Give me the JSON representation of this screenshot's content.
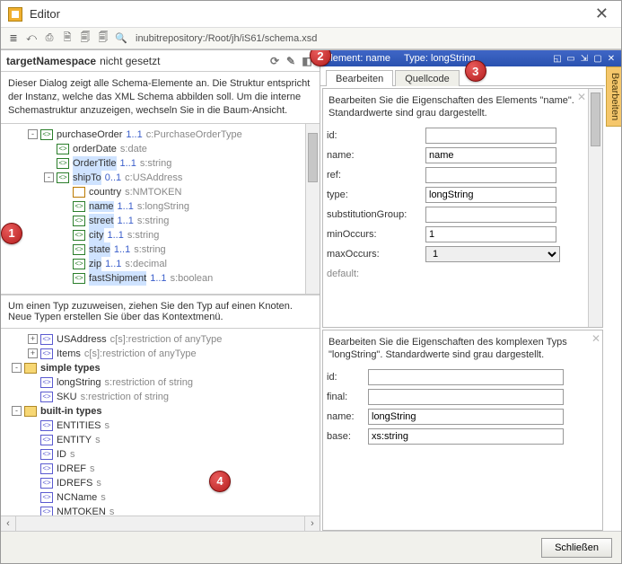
{
  "window": {
    "title": "Editor"
  },
  "toolbar": {
    "path": "inubitrepository:/Root/jh/iS61/schema.xsd"
  },
  "ns": {
    "label": "targetNamespace",
    "status": "nicht gesetzt"
  },
  "leftHint": "Dieser Dialog zeigt alle Schema-Elemente an. Die Struktur entspricht der Instanz, welche das XML Schema abbilden soll. Um die interne Schemastruktur anzuzeigen, wechseln Sie in die Baum-Ansicht.",
  "tree": [
    {
      "depth": 1,
      "exp": "-",
      "icon": "elem",
      "label": "purchaseOrder",
      "occ": "1..1",
      "tinfo": "c:PurchaseOrderType"
    },
    {
      "depth": 2,
      "exp": "",
      "icon": "elem",
      "label": "orderDate",
      "tinfo": "s:date"
    },
    {
      "depth": 2,
      "exp": "",
      "icon": "elem",
      "label": "OrderTitle",
      "occ": "1..1",
      "tinfo": "s:string",
      "hl": true
    },
    {
      "depth": 2,
      "exp": "-",
      "icon": "elem",
      "label": "shipTo",
      "occ": "0..1",
      "tinfo": "c:USAddress",
      "hl": true
    },
    {
      "depth": 3,
      "exp": "",
      "icon": "attr",
      "label": "country",
      "tinfo": "s:NMTOKEN"
    },
    {
      "depth": 3,
      "exp": "",
      "icon": "elem",
      "label": "name",
      "occ": "1..1",
      "tinfo": "s:longString",
      "hl": true,
      "selected": true
    },
    {
      "depth": 3,
      "exp": "",
      "icon": "elem",
      "label": "street",
      "occ": "1..1",
      "tinfo": "s:string",
      "hl": true
    },
    {
      "depth": 3,
      "exp": "",
      "icon": "elem",
      "label": "city",
      "occ": "1..1",
      "tinfo": "s:string",
      "hl": true
    },
    {
      "depth": 3,
      "exp": "",
      "icon": "elem",
      "label": "state",
      "occ": "1..1",
      "tinfo": "s:string",
      "hl": true
    },
    {
      "depth": 3,
      "exp": "",
      "icon": "elem",
      "label": "zip",
      "occ": "1..1",
      "tinfo": "s:decimal",
      "hl": true
    },
    {
      "depth": 3,
      "exp": "",
      "icon": "elem",
      "label": "fastShipment",
      "occ": "1..1",
      "tinfo": "s:boolean",
      "hl": true
    }
  ],
  "typesHint": "Um einen Typ zuzuweisen, ziehen Sie den Typ auf einen Knoten. Neue Typen erstellen Sie über das Kontextmenü.",
  "typesTree": [
    {
      "depth": 1,
      "exp": "+",
      "icon": "type",
      "label": "USAddress",
      "tinfo": "c[s]:restriction of anyType"
    },
    {
      "depth": 1,
      "exp": "+",
      "icon": "type",
      "label": "Items",
      "tinfo": "c[s]:restriction of anyType"
    },
    {
      "depth": 0,
      "exp": "-",
      "icon": "folder",
      "label": "simple types",
      "bold": true
    },
    {
      "depth": 1,
      "exp": "",
      "icon": "type",
      "label": "longString",
      "tinfo": "s:restriction of string",
      "selected": true
    },
    {
      "depth": 1,
      "exp": "",
      "icon": "type",
      "label": "SKU",
      "tinfo": "s:restriction of string"
    },
    {
      "depth": 0,
      "exp": "-",
      "icon": "folder",
      "label": "built-in types",
      "bold": true
    },
    {
      "depth": 1,
      "exp": "",
      "icon": "type",
      "label": "ENTITIES",
      "tinfo": "s"
    },
    {
      "depth": 1,
      "exp": "",
      "icon": "type",
      "label": "ENTITY",
      "tinfo": "s"
    },
    {
      "depth": 1,
      "exp": "",
      "icon": "type",
      "label": "ID",
      "tinfo": "s"
    },
    {
      "depth": 1,
      "exp": "",
      "icon": "type",
      "label": "IDREF",
      "tinfo": "s"
    },
    {
      "depth": 1,
      "exp": "",
      "icon": "type",
      "label": "IDREFS",
      "tinfo": "s"
    },
    {
      "depth": 1,
      "exp": "",
      "icon": "type",
      "label": "NCName",
      "tinfo": "s"
    },
    {
      "depth": 1,
      "exp": "",
      "icon": "type",
      "label": "NMTOKEN",
      "tinfo": "s"
    }
  ],
  "panelHead": {
    "element": "Element: name",
    "type": "Type: longString"
  },
  "sideTab": "Bearbeiten",
  "tabs": {
    "edit": "Bearbeiten",
    "source": "Quellcode"
  },
  "elemForm": {
    "desc": "Bearbeiten Sie die Eigenschaften des Elements \"name\". Standardwerte sind grau dargestellt.",
    "idLabel": "id:",
    "idVal": "",
    "nameLabel": "name:",
    "nameVal": "name",
    "refLabel": "ref:",
    "refVal": "",
    "typeLabel": "type:",
    "typeVal": "longString",
    "substLabel": "substitutionGroup:",
    "substVal": "",
    "minLabel": "minOccurs:",
    "minVal": "1",
    "maxLabel": "maxOccurs:",
    "maxVal": "1",
    "defaultLabel": "default:"
  },
  "typeForm": {
    "desc": "Bearbeiten Sie die Eigenschaften des komplexen Typs \"longString\". Standardwerte sind grau dargestellt.",
    "idLabel": "id:",
    "idVal": "",
    "finalLabel": "final:",
    "finalVal": "",
    "nameLabel": "name:",
    "nameVal": "longString",
    "baseLabel": "base:",
    "baseVal": "xs:string"
  },
  "footer": {
    "close": "Schließen"
  },
  "callouts": {
    "c1": "1",
    "c2": "2",
    "c3": "3",
    "c4": "4"
  }
}
